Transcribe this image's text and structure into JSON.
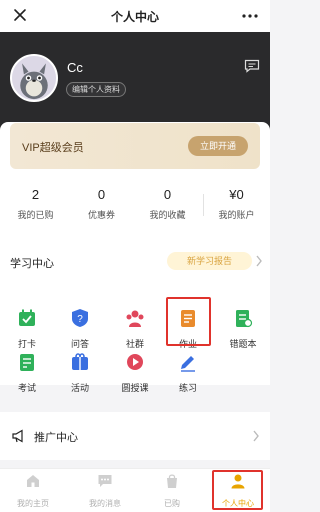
{
  "topbar": {
    "title": "个人中心"
  },
  "profile": {
    "username": "Cc",
    "edit_label": "编辑个人资料"
  },
  "vip": {
    "label": "VIP超级会员",
    "button": "立即开通"
  },
  "stats": [
    {
      "value": "2",
      "label": "我的已购"
    },
    {
      "value": "0",
      "label": "优惠券"
    },
    {
      "value": "0",
      "label": "我的收藏"
    },
    {
      "value": "¥0",
      "label": "我的账户"
    }
  ],
  "study": {
    "title": "学习中心",
    "report_label": "新学习报告",
    "items": [
      {
        "label": "打卡",
        "icon": "checkin-calendar-icon",
        "color": "#2fb15a"
      },
      {
        "label": "问答",
        "icon": "question-icon",
        "color": "#3a6fe0"
      },
      {
        "label": "社群",
        "icon": "community-icon",
        "color": "#e0475b"
      },
      {
        "label": "作业",
        "icon": "homework-icon",
        "color": "#e98b2c"
      },
      {
        "label": "错题本",
        "icon": "wrong-book-icon",
        "color": "#2fb15a"
      },
      {
        "label": "考试",
        "icon": "exam-icon",
        "color": "#2fb15a"
      },
      {
        "label": "活动",
        "icon": "activity-icon",
        "color": "#3a6fe0"
      },
      {
        "label": "圆授课",
        "icon": "lecture-icon",
        "color": "#e0475b"
      },
      {
        "label": "练习",
        "icon": "practice-icon",
        "color": "#3a6fe0"
      }
    ]
  },
  "promo": {
    "label": "推广中心"
  },
  "tabs": [
    {
      "label": "我的主页",
      "icon": "home-icon",
      "active": false
    },
    {
      "label": "我的消息",
      "icon": "message-icon",
      "active": false
    },
    {
      "label": "已购",
      "icon": "purchased-icon",
      "active": false
    },
    {
      "label": "个人中心",
      "icon": "person-icon",
      "active": true
    }
  ],
  "colors": {
    "accent": "#e8a400",
    "highlight": "#e0332c",
    "vip_button": "#c7a36e",
    "header_bg": "#2a2a2c"
  }
}
